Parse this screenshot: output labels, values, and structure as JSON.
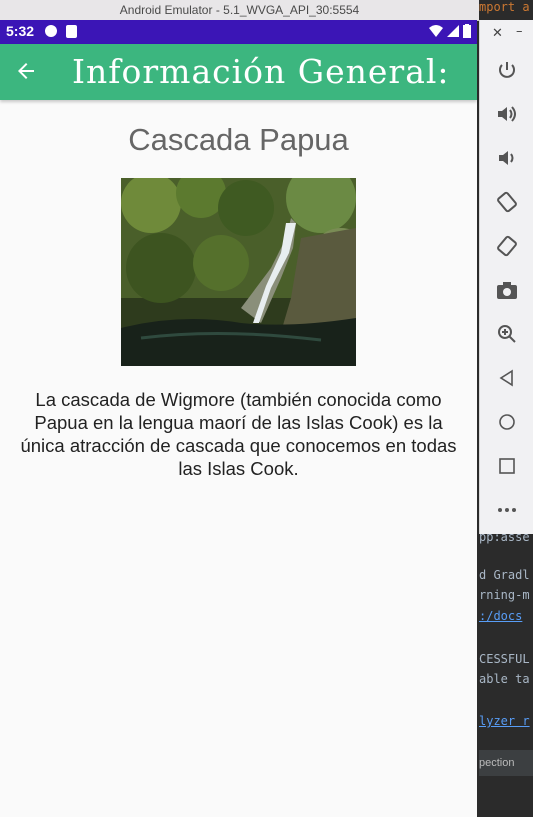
{
  "window": {
    "title": "Android Emulator - 5.1_WVGA_API_30:5554"
  },
  "status_bar": {
    "time": "5:32"
  },
  "app_bar": {
    "title": "Información General:"
  },
  "place": {
    "name": "Cascada Papua",
    "description": "La cascada de Wigmore (también conocida como Papua en la lengua maorí de las Islas Cook) es la única atracción de cascada que conocemos en todas las Islas Cook."
  },
  "emulator_toolbar": {
    "tools": [
      "power-icon",
      "volume-up-icon",
      "volume-down-icon",
      "rotate-left-icon",
      "rotate-right-icon",
      "camera-icon",
      "zoom-icon",
      "back-icon",
      "home-icon",
      "overview-icon",
      "more-icon"
    ]
  },
  "ide": {
    "top_text": "mport a",
    "lines": [
      "pp:asse",
      "d Gradl",
      "rning-m",
      ":/docs",
      "CESSFUL",
      "able ta",
      "lyzer r"
    ],
    "tab": "pection"
  }
}
